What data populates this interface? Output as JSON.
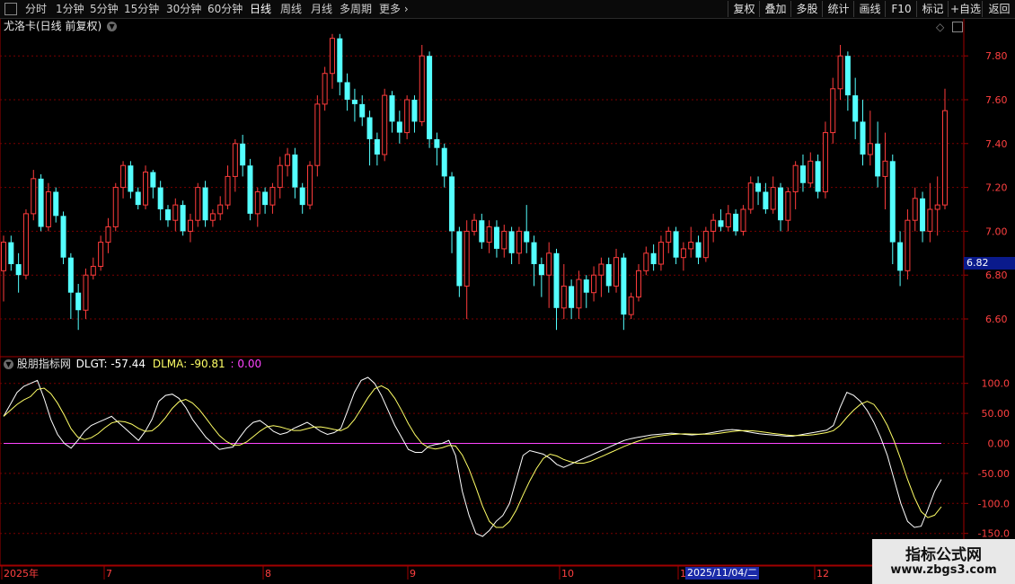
{
  "toolbar": {
    "periods": [
      "分时",
      "1分钟",
      "5分钟",
      "15分钟",
      "30分钟",
      "60分钟",
      "日线",
      "周线",
      "月线",
      "多周期",
      "更多"
    ],
    "active_period": "日线",
    "buttons": [
      "复权",
      "叠加",
      "多股",
      "统计",
      "画线",
      "F10",
      "标记",
      "+自选",
      "返回"
    ]
  },
  "main_panel": {
    "title": "尤洛卡(日线 前复权)",
    "price_axis": [
      "7.80",
      "7.60",
      "7.40",
      "7.20",
      "7.00",
      "6.80",
      "6.60"
    ],
    "current_price": "6.82"
  },
  "indicator_panel": {
    "name": "股朋指标网",
    "dlgt_label": "DLGT: -57.44",
    "dlma_label": "DLMA: -90.81",
    "zero_label": ": 0.00",
    "axis": [
      "100.0",
      "50.00",
      "0.00",
      "-50.00",
      "-100.0",
      "-150.0"
    ]
  },
  "time_axis": {
    "labels": [
      "2025年",
      "7",
      "8",
      "9",
      "10",
      "11",
      "12"
    ],
    "cursor_date": "2025/11/04/二"
  },
  "watermark": {
    "title": "指标公式网",
    "url": "www.zbgs3.com"
  },
  "colors": {
    "up": "#ff3c3c",
    "down": "#54ffff",
    "dlgt": "#ffffff",
    "dlma": "#ffff66",
    "zero": "#ff44ff",
    "grid": "#7a0000"
  },
  "chart_data": {
    "type": "candlestick",
    "price_range": [
      6.48,
      7.9
    ],
    "candles": [
      [
        6.82,
        6.95,
        6.98,
        6.68
      ],
      [
        6.95,
        6.85,
        6.98,
        6.82
      ],
      [
        6.85,
        6.8,
        6.9,
        6.72
      ],
      [
        6.8,
        7.08,
        7.1,
        6.78
      ],
      [
        7.08,
        7.24,
        7.28,
        7.05
      ],
      [
        7.24,
        7.02,
        7.26,
        7.0
      ],
      [
        7.02,
        7.18,
        7.22,
        7.0
      ],
      [
        7.18,
        7.07,
        7.2,
        7.04
      ],
      [
        7.07,
        6.88,
        7.09,
        6.85
      ],
      [
        6.88,
        6.72,
        6.9,
        6.6
      ],
      [
        6.72,
        6.64,
        6.76,
        6.55
      ],
      [
        6.64,
        6.8,
        6.83,
        6.6
      ],
      [
        6.8,
        6.84,
        6.88,
        6.78
      ],
      [
        6.84,
        6.95,
        6.98,
        6.82
      ],
      [
        6.95,
        7.02,
        7.06,
        6.9
      ],
      [
        7.02,
        7.2,
        7.22,
        7.0
      ],
      [
        7.2,
        7.3,
        7.32,
        7.15
      ],
      [
        7.3,
        7.18,
        7.32,
        7.15
      ],
      [
        7.18,
        7.12,
        7.2,
        7.1
      ],
      [
        7.12,
        7.27,
        7.3,
        7.1
      ],
      [
        7.27,
        7.2,
        7.28,
        7.15
      ],
      [
        7.2,
        7.1,
        7.23,
        7.05
      ],
      [
        7.1,
        7.05,
        7.12,
        7.02
      ],
      [
        7.05,
        7.12,
        7.15,
        7.0
      ],
      [
        7.12,
        7.0,
        7.14,
        6.98
      ],
      [
        7.0,
        7.05,
        7.08,
        6.95
      ],
      [
        7.05,
        7.2,
        7.22,
        7.02
      ],
      [
        7.2,
        7.05,
        7.23,
        7.02
      ],
      [
        7.05,
        7.08,
        7.1,
        7.02
      ],
      [
        7.08,
        7.12,
        7.16,
        7.05
      ],
      [
        7.12,
        7.25,
        7.3,
        7.1
      ],
      [
        7.25,
        7.4,
        7.42,
        7.18
      ],
      [
        7.4,
        7.3,
        7.44,
        7.25
      ],
      [
        7.3,
        7.08,
        7.33,
        7.05
      ],
      [
        7.08,
        7.18,
        7.2,
        7.02
      ],
      [
        7.18,
        7.12,
        7.2,
        7.08
      ],
      [
        7.12,
        7.2,
        7.22,
        7.08
      ],
      [
        7.2,
        7.3,
        7.34,
        7.15
      ],
      [
        7.3,
        7.35,
        7.38,
        7.25
      ],
      [
        7.35,
        7.2,
        7.38,
        7.15
      ],
      [
        7.2,
        7.12,
        7.22,
        7.08
      ],
      [
        7.12,
        7.3,
        7.32,
        7.1
      ],
      [
        7.3,
        7.58,
        7.62,
        7.25
      ],
      [
        7.58,
        7.72,
        7.75,
        7.55
      ],
      [
        7.72,
        7.88,
        7.9,
        7.65
      ],
      [
        7.88,
        7.68,
        7.9,
        7.62
      ],
      [
        7.68,
        7.6,
        7.72,
        7.55
      ],
      [
        7.6,
        7.58,
        7.65,
        7.5
      ],
      [
        7.58,
        7.52,
        7.62,
        7.48
      ],
      [
        7.52,
        7.42,
        7.55,
        7.3
      ],
      [
        7.42,
        7.35,
        7.45,
        7.3
      ],
      [
        7.35,
        7.62,
        7.65,
        7.32
      ],
      [
        7.62,
        7.5,
        7.64,
        7.45
      ],
      [
        7.5,
        7.45,
        7.55,
        7.4
      ],
      [
        7.45,
        7.6,
        7.62,
        7.42
      ],
      [
        7.6,
        7.5,
        7.62,
        7.45
      ],
      [
        7.5,
        7.8,
        7.85,
        7.48
      ],
      [
        7.8,
        7.42,
        7.82,
        7.38
      ],
      [
        7.42,
        7.38,
        7.45,
        7.3
      ],
      [
        7.38,
        7.25,
        7.4,
        7.2
      ],
      [
        7.25,
        7.0,
        7.27,
        6.9
      ],
      [
        7.0,
        6.75,
        7.02,
        6.7
      ],
      [
        6.75,
        7.0,
        7.05,
        6.6
      ],
      [
        7.0,
        7.05,
        7.08,
        6.98
      ],
      [
        7.05,
        6.95,
        7.08,
        6.92
      ],
      [
        6.95,
        7.02,
        7.05,
        6.9
      ],
      [
        7.02,
        6.92,
        7.05,
        6.88
      ],
      [
        6.92,
        7.0,
        7.03,
        6.88
      ],
      [
        7.0,
        6.9,
        7.02,
        6.85
      ],
      [
        6.9,
        7.0,
        7.02,
        6.85
      ],
      [
        7.0,
        6.95,
        7.12,
        6.9
      ],
      [
        6.95,
        6.85,
        6.98,
        6.75
      ],
      [
        6.85,
        6.8,
        6.88,
        6.7
      ],
      [
        6.8,
        6.9,
        6.95,
        6.65
      ],
      [
        6.9,
        6.65,
        6.92,
        6.55
      ],
      [
        6.65,
        6.75,
        6.85,
        6.6
      ],
      [
        6.75,
        6.65,
        6.78,
        6.6
      ],
      [
        6.65,
        6.78,
        6.82,
        6.6
      ],
      [
        6.78,
        6.72,
        6.8,
        6.65
      ],
      [
        6.72,
        6.8,
        6.84,
        6.68
      ],
      [
        6.8,
        6.85,
        6.88,
        6.7
      ],
      [
        6.85,
        6.75,
        6.88,
        6.72
      ],
      [
        6.75,
        6.88,
        6.92,
        6.72
      ],
      [
        6.88,
        6.62,
        6.9,
        6.55
      ],
      [
        6.62,
        6.7,
        6.72,
        6.6
      ],
      [
        6.7,
        6.82,
        6.85,
        6.68
      ],
      [
        6.82,
        6.9,
        6.93,
        6.8
      ],
      [
        6.9,
        6.85,
        6.94,
        6.82
      ],
      [
        6.85,
        6.95,
        6.98,
        6.82
      ],
      [
        6.95,
        7.0,
        7.02,
        6.9
      ],
      [
        7.0,
        6.88,
        7.02,
        6.85
      ],
      [
        6.88,
        6.92,
        6.95,
        6.82
      ],
      [
        6.92,
        6.95,
        7.02,
        6.88
      ],
      [
        6.95,
        6.88,
        6.98,
        6.85
      ],
      [
        6.88,
        7.0,
        7.02,
        6.86
      ],
      [
        7.0,
        7.05,
        7.08,
        6.95
      ],
      [
        7.05,
        7.02,
        7.1,
        7.0
      ],
      [
        7.02,
        7.08,
        7.12,
        7.0
      ],
      [
        7.08,
        7.0,
        7.1,
        6.98
      ],
      [
        7.0,
        7.1,
        7.12,
        6.98
      ],
      [
        7.1,
        7.22,
        7.25,
        7.08
      ],
      [
        7.22,
        7.18,
        7.25,
        7.12
      ],
      [
        7.18,
        7.1,
        7.22,
        7.08
      ],
      [
        7.1,
        7.2,
        7.25,
        7.08
      ],
      [
        7.2,
        7.05,
        7.22,
        7.0
      ],
      [
        7.05,
        7.18,
        7.2,
        7.0
      ],
      [
        7.18,
        7.3,
        7.32,
        7.1
      ],
      [
        7.3,
        7.22,
        7.35,
        7.18
      ],
      [
        7.22,
        7.32,
        7.36,
        7.2
      ],
      [
        7.32,
        7.18,
        7.35,
        7.15
      ],
      [
        7.18,
        7.45,
        7.5,
        7.15
      ],
      [
        7.45,
        7.65,
        7.7,
        7.4
      ],
      [
        7.65,
        7.8,
        7.85,
        7.6
      ],
      [
        7.8,
        7.62,
        7.82,
        7.55
      ],
      [
        7.62,
        7.5,
        7.7,
        7.42
      ],
      [
        7.5,
        7.35,
        7.6,
        7.3
      ],
      [
        7.35,
        7.4,
        7.55,
        7.3
      ],
      [
        7.4,
        7.25,
        7.5,
        7.2
      ],
      [
        7.25,
        7.32,
        7.45,
        7.1
      ],
      [
        7.32,
        6.95,
        7.35,
        6.85
      ],
      [
        6.95,
        6.82,
        7.0,
        6.75
      ],
      [
        6.82,
        7.05,
        7.1,
        6.78
      ],
      [
        7.05,
        7.15,
        7.2,
        7.0
      ],
      [
        7.15,
        7.0,
        7.18,
        6.95
      ],
      [
        7.0,
        7.1,
        7.22,
        6.95
      ],
      [
        7.1,
        7.12,
        7.25,
        6.98
      ],
      [
        7.12,
        7.55,
        7.65,
        7.1
      ]
    ],
    "dlgt": [
      45,
      65,
      85,
      95,
      100,
      105,
      75,
      40,
      15,
      0,
      -8,
      5,
      20,
      30,
      35,
      40,
      45,
      35,
      25,
      15,
      5,
      20,
      40,
      70,
      80,
      82,
      75,
      60,
      40,
      25,
      10,
      0,
      -10,
      -8,
      -6,
      10,
      25,
      35,
      38,
      30,
      20,
      15,
      18,
      25,
      30,
      35,
      28,
      20,
      15,
      18,
      25,
      55,
      85,
      105,
      110,
      100,
      80,
      55,
      30,
      10,
      -10,
      -15,
      -15,
      -5,
      -2,
      0,
      5,
      -20,
      -80,
      -120,
      -150,
      -155,
      -145,
      -130,
      -120,
      -100,
      -60,
      -20,
      -12,
      -15,
      -18,
      -25,
      -35,
      -40,
      -35,
      -30,
      -25,
      -20,
      -15,
      -10,
      -5,
      0,
      5,
      8,
      10,
      12,
      14,
      15,
      16,
      17,
      16,
      15,
      14,
      15,
      16,
      18,
      20,
      22,
      23,
      22,
      20,
      18,
      16,
      15,
      14,
      13,
      12,
      12,
      14,
      16,
      18,
      20,
      22,
      30,
      60,
      85,
      80,
      70,
      55,
      35,
      10,
      -20,
      -60,
      -100,
      -130,
      -140,
      -138,
      -110,
      -80,
      -60
    ]
  }
}
